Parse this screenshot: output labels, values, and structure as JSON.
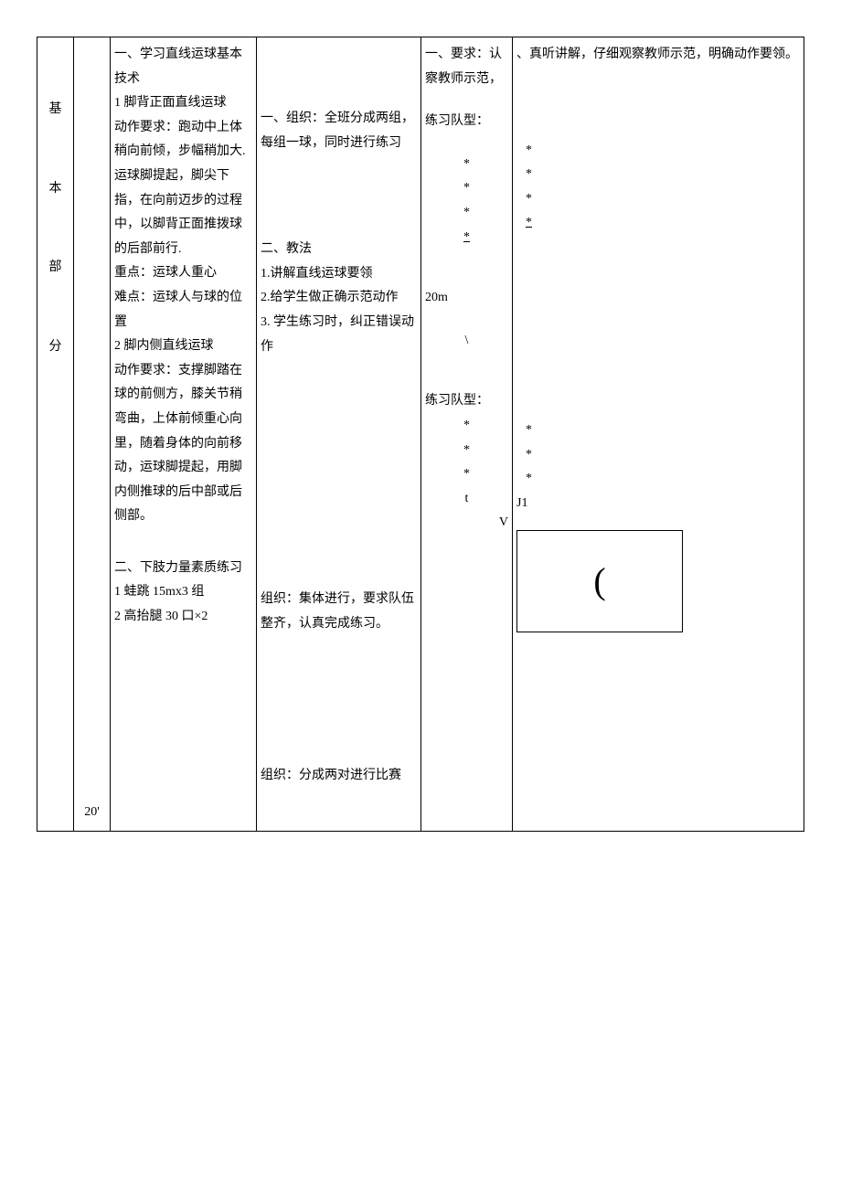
{
  "section": {
    "col1_chars": [
      "基",
      "本",
      "部",
      "分"
    ],
    "col2_value": "20'"
  },
  "content": {
    "c1_title": "一、学习直线运球基本技术",
    "c1_sub1": "1 脚背正面直线运球",
    "c1_action_req": "动作要求：跑动中上体稍向前倾，步幅稍加大. 运球脚提起，脚尖下指，在向前迈步的过程中，以脚背正面推拨球的后部前行.",
    "c1_key": "重点：运球人重心",
    "c1_hard": "难点：运球人与球的位置",
    "c1_sub2": "2 脚内侧直线运球",
    "c1_action_req2": "动作要求：支撑脚踏在球的前侧方，膝关节稍弯曲，上体前倾重心向里，随着身体的向前移动，运球脚提起，用脚内侧推球的后中部或后侧部。",
    "c1_title2": "二、下肢力量素质练习",
    "c1_item1": "1 蛙跳 15mx3 组",
    "c1_item2": "2 高抬腿 30 口×2"
  },
  "teaching": {
    "org1": "一、组织：全班分成两组，每组一球，同时进行练习",
    "method_title": "二、教法",
    "m1": "1.讲解直线运球要领",
    "m2": "2.给学生做正确示范动作",
    "m3": "3. 学生练习时，纠正错误动作",
    "org2": "组织：集体进行，要求队伍整齐，认真完成练习。",
    "org3": "组织：分成两对进行比赛"
  },
  "req": {
    "r1_a": "一、要求：认",
    "r1_b": "、真听讲解，仔细观察教师示范，明确动作要领。",
    "f1": "练习队型：",
    "f2": "练习队型：",
    "dist": "20m",
    "star": "*",
    "slash": "\\",
    "t": "t",
    "j1": "J1",
    "v": "V",
    "paren": "("
  }
}
